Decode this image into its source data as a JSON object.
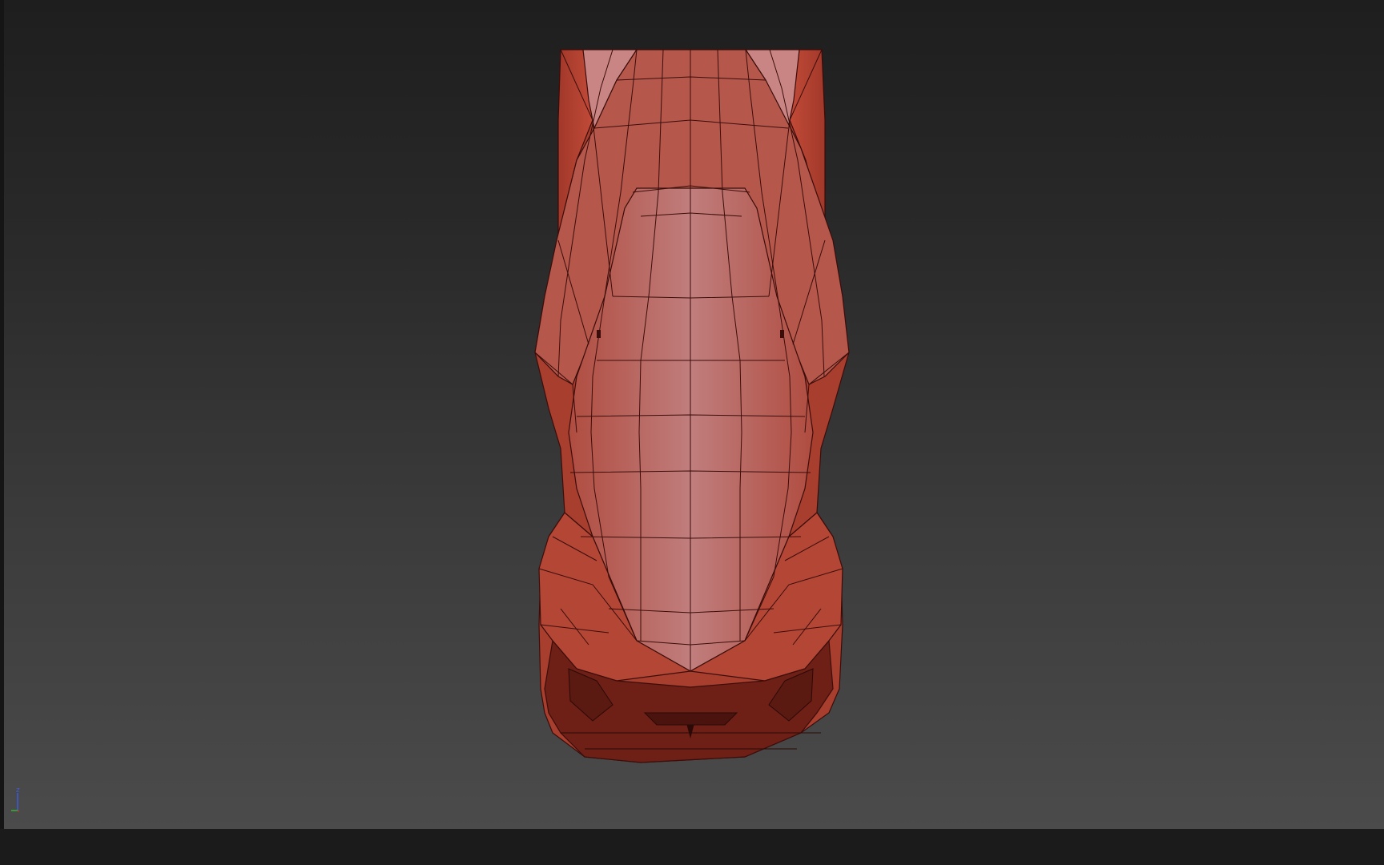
{
  "viewport": {
    "name": "perspective-viewport",
    "model": "car-body-wireframe-top-view",
    "colors": {
      "background_top": "#1e1e1e",
      "background_bottom": "#4b4b4b",
      "body": "#b24a3a",
      "body_highlight": "#c07a77",
      "wire": "#3a0d0a"
    }
  },
  "gizmo": {
    "axis_label": "z",
    "colors": {
      "x": "#c83232",
      "y": "#32b432",
      "z": "#3b5bd8"
    }
  }
}
